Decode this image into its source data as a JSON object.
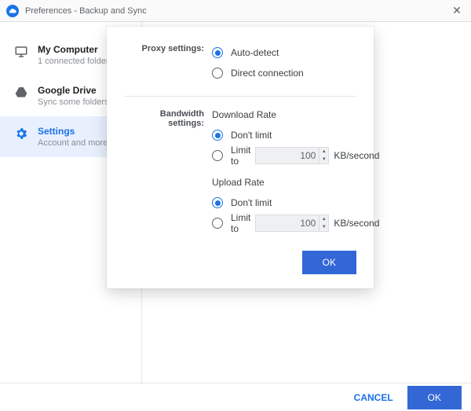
{
  "window": {
    "title": "Preferences - Backup and Sync",
    "close_label": "✕"
  },
  "sidebar": {
    "items": [
      {
        "name": "My Computer",
        "desc": "1 connected folder"
      },
      {
        "name": "Google Drive",
        "desc": "Sync some folders"
      },
      {
        "name": "Settings",
        "desc": "Account and more"
      }
    ]
  },
  "dialog": {
    "proxy_label": "Proxy settings:",
    "bandwidth_label": "Bandwidth settings:",
    "proxy": {
      "auto": "Auto-detect",
      "direct": "Direct connection"
    },
    "download": {
      "title": "Download Rate",
      "dont_limit": "Don't limit",
      "limit_to": "Limit to",
      "value": "100",
      "unit": "KB/second"
    },
    "upload": {
      "title": "Upload Rate",
      "dont_limit": "Don't limit",
      "limit_to": "Limit to",
      "value": "100",
      "unit": "KB/second"
    },
    "ok": "OK"
  },
  "footer": {
    "cancel": "CANCEL",
    "ok": "OK"
  }
}
